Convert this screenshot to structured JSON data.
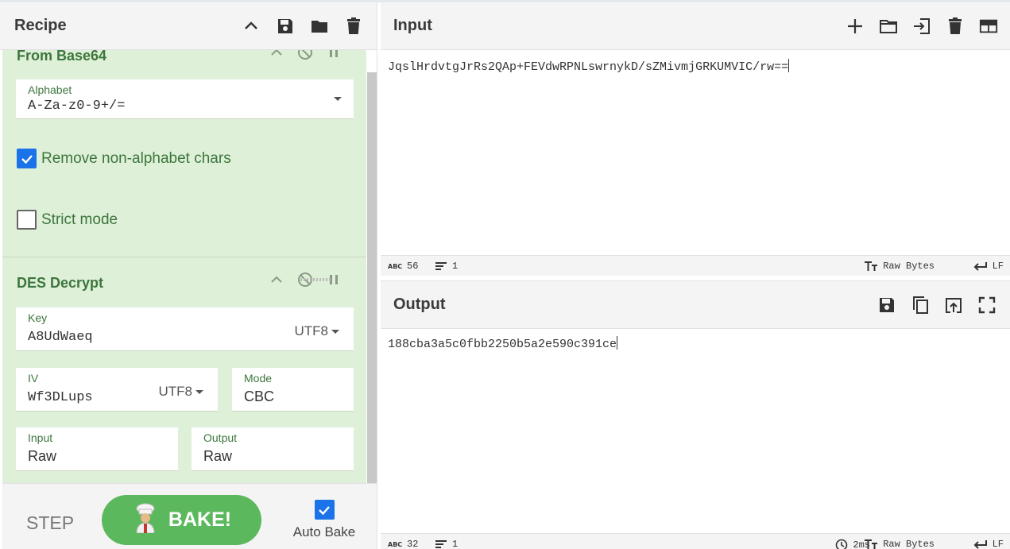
{
  "recipe": {
    "title": "Recipe",
    "operations": [
      {
        "name": "From Base64",
        "alphabet_label": "Alphabet",
        "alphabet_value": "A-Za-z0-9+/=",
        "remove_nonalpha_label": "Remove non-alphabet chars",
        "remove_nonalpha_checked": true,
        "strict_label": "Strict mode",
        "strict_checked": false
      },
      {
        "name": "DES Decrypt",
        "key_label": "Key",
        "key_value": "A8UdWaeq",
        "key_encoding": "UTF8",
        "iv_label": "IV",
        "iv_value": "Wf3DLups",
        "iv_encoding": "UTF8",
        "mode_label": "Mode",
        "mode_value": "CBC",
        "input_label": "Input",
        "input_value": "Raw",
        "output_label": "Output",
        "output_value": "Raw"
      }
    ]
  },
  "controls": {
    "step_label": "STEP",
    "bake_label": "BAKE!",
    "autobake_label": "Auto Bake",
    "autobake_checked": true
  },
  "input": {
    "title": "Input",
    "text": "JqslHrdvtgJrRs2QAp+FEVdwRPNLswrnykD/sZMivmjGRKUMVIC/rw==",
    "status": {
      "length": "56",
      "lines": "1",
      "encoding": "Raw Bytes",
      "eol": "LF"
    }
  },
  "output": {
    "title": "Output",
    "text": "188cba3a5c0fbb2250b5a2e590c391ce",
    "status": {
      "length": "32",
      "lines": "1",
      "time": "2ms",
      "encoding": "Raw Bytes",
      "eol": "LF"
    }
  },
  "colors": {
    "accent_green": "#5cb85c",
    "op_bg": "#dff0d8",
    "op_text": "#3c763d",
    "checkbox_blue": "#1a73e8"
  }
}
